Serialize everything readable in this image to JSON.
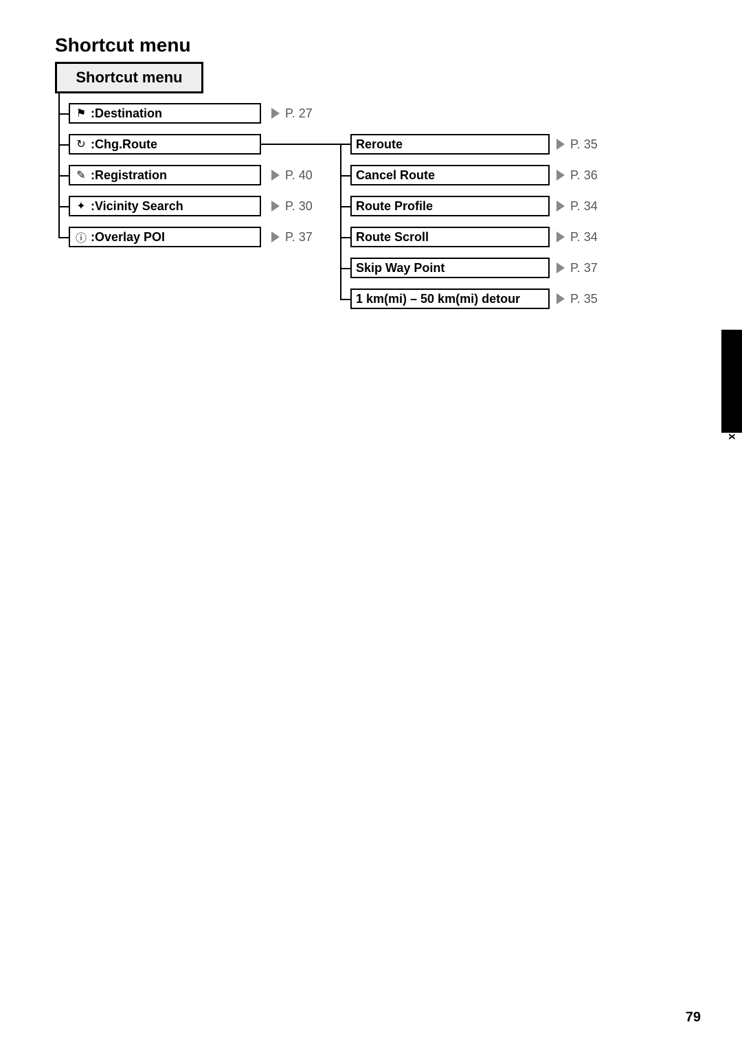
{
  "title": "Shortcut menu",
  "root": "Shortcut menu",
  "left_items": [
    {
      "icon": "⚑",
      "label": ":Destination",
      "page": "P. 27"
    },
    {
      "icon": "↻",
      "label": ":Chg.Route",
      "page": ""
    },
    {
      "icon": "✎",
      "label": ":Registration",
      "page": "P. 40"
    },
    {
      "icon": "✦",
      "label": ":Vicinity Search",
      "page": "P. 30"
    },
    {
      "icon": "ⓘ",
      "label": ":Overlay POI",
      "page": "P. 37"
    }
  ],
  "right_items": [
    {
      "label": "Reroute",
      "page": "P. 35"
    },
    {
      "label": "Cancel Route",
      "page": "P. 36"
    },
    {
      "label": "Route Profile",
      "page": "P. 34"
    },
    {
      "label": "Route Scroll",
      "page": "P. 34"
    },
    {
      "label": "Skip Way Point",
      "page": "P. 37"
    },
    {
      "label": "1 km(mi) – 50 km(mi) detour",
      "page": "P. 35"
    }
  ],
  "side_label": "Appendix",
  "page_number": "79"
}
